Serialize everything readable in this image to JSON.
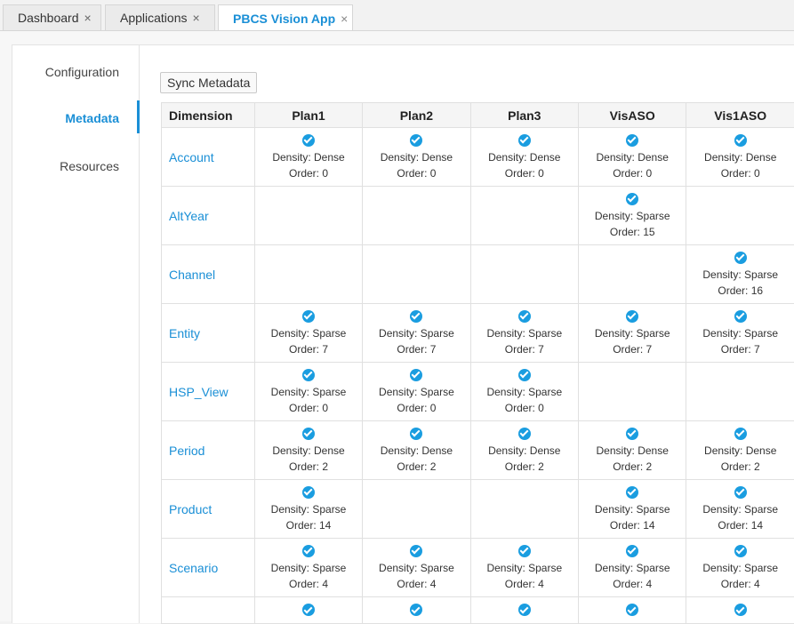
{
  "tabs": [
    {
      "label": "Dashboard"
    },
    {
      "label": "Applications"
    },
    {
      "label": "PBCS Vision App",
      "active": true
    }
  ],
  "close_glyph": "×",
  "sidebar": {
    "items": [
      {
        "label": "Configuration"
      },
      {
        "label": "Metadata",
        "active": true
      },
      {
        "label": "Resources"
      }
    ]
  },
  "toolbar": {
    "sync_label": "Sync Metadata"
  },
  "table": {
    "dimension_header": "Dimension",
    "columns": [
      "Plan1",
      "Plan2",
      "Plan3",
      "VisASO",
      "Vis1ASO"
    ],
    "rows": [
      {
        "name": "Account",
        "cells": [
          {
            "density": "Density: Dense",
            "order": "Order: 0"
          },
          {
            "density": "Density: Dense",
            "order": "Order: 0"
          },
          {
            "density": "Density: Dense",
            "order": "Order: 0"
          },
          {
            "density": "Density: Dense",
            "order": "Order: 0"
          },
          {
            "density": "Density: Dense",
            "order": "Order: 0"
          }
        ]
      },
      {
        "name": "AltYear",
        "cells": [
          null,
          null,
          null,
          {
            "density": "Density: Sparse",
            "order": "Order: 15"
          },
          null
        ]
      },
      {
        "name": "Channel",
        "cells": [
          null,
          null,
          null,
          null,
          {
            "density": "Density: Sparse",
            "order": "Order: 16"
          }
        ]
      },
      {
        "name": "Entity",
        "cells": [
          {
            "density": "Density: Sparse",
            "order": "Order: 7"
          },
          {
            "density": "Density: Sparse",
            "order": "Order: 7"
          },
          {
            "density": "Density: Sparse",
            "order": "Order: 7"
          },
          {
            "density": "Density: Sparse",
            "order": "Order: 7"
          },
          {
            "density": "Density: Sparse",
            "order": "Order: 7"
          }
        ]
      },
      {
        "name": "HSP_View",
        "cells": [
          {
            "density": "Density: Sparse",
            "order": "Order: 0"
          },
          {
            "density": "Density: Sparse",
            "order": "Order: 0"
          },
          {
            "density": "Density: Sparse",
            "order": "Order: 0"
          },
          null,
          null
        ]
      },
      {
        "name": "Period",
        "cells": [
          {
            "density": "Density: Dense",
            "order": "Order: 2"
          },
          {
            "density": "Density: Dense",
            "order": "Order: 2"
          },
          {
            "density": "Density: Dense",
            "order": "Order: 2"
          },
          {
            "density": "Density: Dense",
            "order": "Order: 2"
          },
          {
            "density": "Density: Dense",
            "order": "Order: 2"
          }
        ]
      },
      {
        "name": "Product",
        "cells": [
          {
            "density": "Density: Sparse",
            "order": "Order: 14"
          },
          null,
          null,
          {
            "density": "Density: Sparse",
            "order": "Order: 14"
          },
          {
            "density": "Density: Sparse",
            "order": "Order: 14"
          }
        ]
      },
      {
        "name": "Scenario",
        "cells": [
          {
            "density": "Density: Sparse",
            "order": "Order: 4"
          },
          {
            "density": "Density: Sparse",
            "order": "Order: 4"
          },
          {
            "density": "Density: Sparse",
            "order": "Order: 4"
          },
          {
            "density": "Density: Sparse",
            "order": "Order: 4"
          },
          {
            "density": "Density: Sparse",
            "order": "Order: 4"
          }
        ]
      }
    ],
    "partial_row_checks": [
      true,
      true,
      true,
      true,
      true
    ]
  }
}
